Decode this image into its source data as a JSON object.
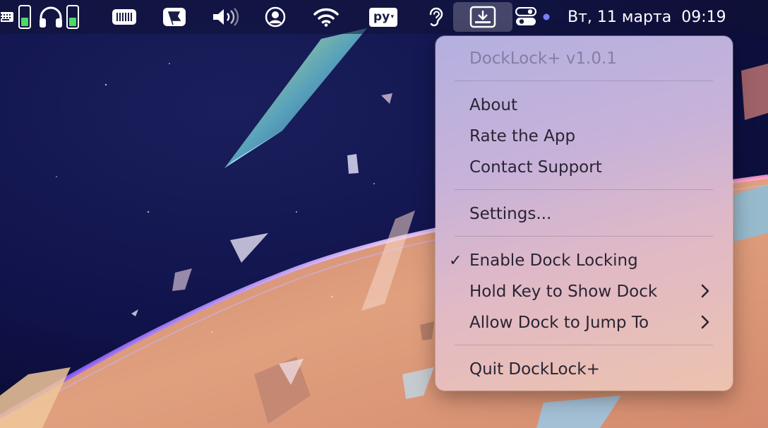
{
  "menubar": {
    "icons": [
      "keyboard-icon",
      "battery-icon",
      "headphones-icon",
      "battery-icon",
      "barcode-icon",
      "flag-icon",
      "volume-icon",
      "user-icon",
      "wifi-icon",
      "input-source-icon",
      "hearing-icon",
      "dock-download-icon",
      "control-center-icon",
      "dot-icon"
    ],
    "input_source": "ру",
    "clock": {
      "date": "Вт, 11 марта",
      "time": "09:19"
    }
  },
  "menu": {
    "title": "DockLock+ v1.0.1",
    "items": [
      {
        "label": "About"
      },
      {
        "label": "Rate the App"
      },
      {
        "label": "Contact Support"
      },
      {
        "label": "Settings..."
      },
      {
        "label": "Enable Dock Locking",
        "checked": true
      },
      {
        "label": "Hold Key to Show Dock",
        "submenu": true
      },
      {
        "label": "Allow Dock to Jump To",
        "submenu": true
      },
      {
        "label": "Quit DockLock+"
      }
    ]
  },
  "colors": {
    "wallpaper_dark": "#0d1036",
    "menu_text": "#2a2434",
    "menu_disabled": "#8a839a",
    "accent_dot": "#7b7cff"
  }
}
